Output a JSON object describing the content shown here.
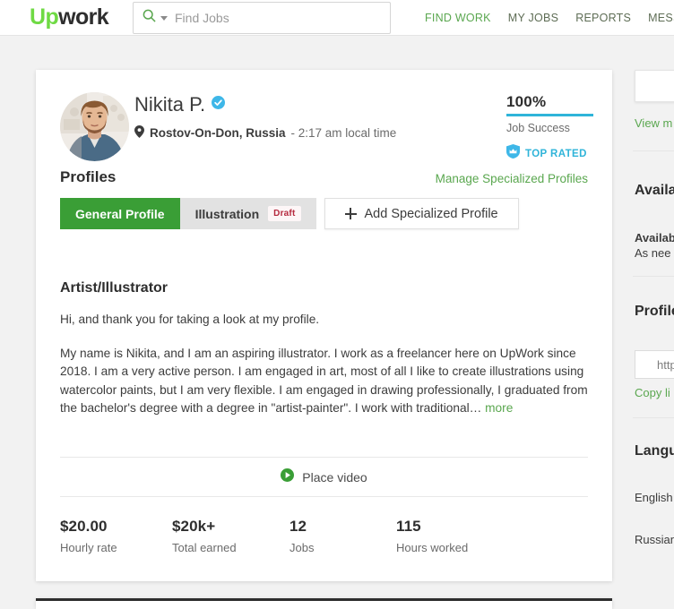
{
  "brand": {
    "logo_up": "Up",
    "logo_work": "work",
    "green": "#6fda44",
    "link_green": "#5aa74f",
    "accent_blue": "#2fb4d9",
    "tab_green": "#3a9e36"
  },
  "search": {
    "placeholder": "Find Jobs",
    "icon": "search-icon",
    "caret_icon": "chevron-down-icon"
  },
  "nav": {
    "items": [
      {
        "label": "FIND WORK",
        "active": true
      },
      {
        "label": "MY JOBS",
        "active": false
      },
      {
        "label": "REPORTS",
        "active": false
      },
      {
        "label": "MESSAGES",
        "active": false
      }
    ]
  },
  "profile": {
    "name": "Nikita P.",
    "verified_icon": "verified-check-icon",
    "location_icon": "location-pin-icon",
    "location": "Rostov-On-Don, Russia",
    "local_time": "- 2:17 am local time",
    "job_success_pct": "100%",
    "job_success_label": "Job Success",
    "top_rated_label": "TOP RATED",
    "top_rated_icon": "top-rated-shield-icon"
  },
  "profiles_section": {
    "title": "Profiles",
    "manage_link": "Manage Specialized Profiles",
    "tabs": [
      {
        "label": "General Profile",
        "state": "active"
      },
      {
        "label": "Illustration",
        "badge": "Draft",
        "state": "inactive"
      }
    ],
    "add_button": "Add Specialized Profile",
    "add_icon": "plus-icon"
  },
  "bio": {
    "title": "Artist/Illustrator",
    "paragraph1": "Hi, and thank you for taking a look at my profile.",
    "paragraph2": "My name is Nikita, and I am an aspiring illustrator. I work as a freelancer here on UpWork since 2018.\nI am a very active person. I am engaged in art, most of all I like to create illustrations using watercolor paints, but I am very flexible. I am engaged in drawing professionally, I graduated from the bachelor's degree with a degree in \"artist-painter\". I work with traditional…",
    "more_link": "more"
  },
  "video": {
    "label": "Place video",
    "icon": "play-circle-icon"
  },
  "stats": [
    {
      "value": "$20.00",
      "label": "Hourly rate"
    },
    {
      "value": "$20k+",
      "label": "Total earned"
    },
    {
      "value": "12",
      "label": "Jobs"
    },
    {
      "value": "115",
      "label": "Hours worked"
    }
  ],
  "sidebar": {
    "view_link": "View m",
    "availability_heading": "Availa",
    "availability_value": "Availab",
    "availability_detail": "As nee",
    "profile_link_heading": "Profile",
    "profile_link_value": "http",
    "copy_link": "Copy li",
    "languages_heading": "Langu",
    "languages": [
      "English",
      "Russian"
    ]
  }
}
